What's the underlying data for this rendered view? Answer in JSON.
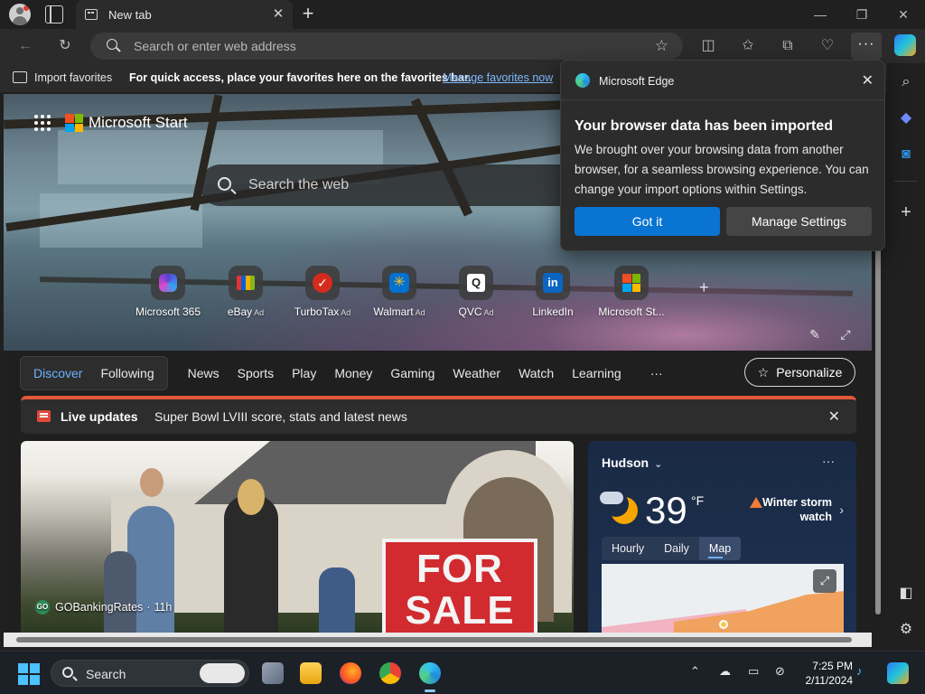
{
  "browser": {
    "tab_title": "New tab",
    "address_placeholder": "Search or enter web address"
  },
  "favorites_bar": {
    "import_label": "Import favorites",
    "hint": "For quick access, place your favorites here on the favorites bar.",
    "manage_link": "Manage favorites now"
  },
  "start_page": {
    "brand": "Microsoft Start",
    "search_placeholder": "Search the web",
    "quick_links": [
      {
        "label": "Microsoft 365",
        "ad": ""
      },
      {
        "label": "eBay",
        "ad": "Ad"
      },
      {
        "label": "TurboTax",
        "ad": "Ad"
      },
      {
        "label": "Walmart",
        "ad": "Ad"
      },
      {
        "label": "QVC",
        "ad": "Ad"
      },
      {
        "label": "LinkedIn",
        "ad": ""
      },
      {
        "label": "Microsoft St...",
        "ad": ""
      }
    ]
  },
  "feed": {
    "pills": [
      "Discover",
      "Following"
    ],
    "nav": [
      "News",
      "Sports",
      "Play",
      "Money",
      "Gaming",
      "Weather",
      "Watch",
      "Learning"
    ],
    "more": "···",
    "personalize": "Personalize",
    "live_updates": {
      "title": "Live updates",
      "text": "Super Bowl LVIII score, stats and latest news"
    },
    "news_card": {
      "source": "GOBankingRates",
      "source_badge": "GO",
      "age": "11h",
      "sign_line1": "FOR",
      "sign_line2": "SALE"
    }
  },
  "weather": {
    "location": "Hudson",
    "temperature": "39",
    "unit": "°F",
    "alert_line1": "Winter storm",
    "alert_line2": "watch",
    "tabs": [
      "Hourly",
      "Daily",
      "Map"
    ],
    "active_tab": "Map"
  },
  "popup": {
    "app_name": "Microsoft Edge",
    "title": "Your browser data has been imported",
    "body": "We brought over your browsing data from another browser, for a seamless browsing experience. You can change your import options within Settings.",
    "primary_button": "Got it",
    "secondary_button": "Manage Settings"
  },
  "taskbar": {
    "search_label": "Search",
    "time": "7:25 PM",
    "date": "2/11/2024"
  },
  "colors": {
    "accent": "#0a74d2",
    "link": "#7fb9ff",
    "live_bar_accent": "#e2593a",
    "popup_bg": "#2c2c2c"
  }
}
